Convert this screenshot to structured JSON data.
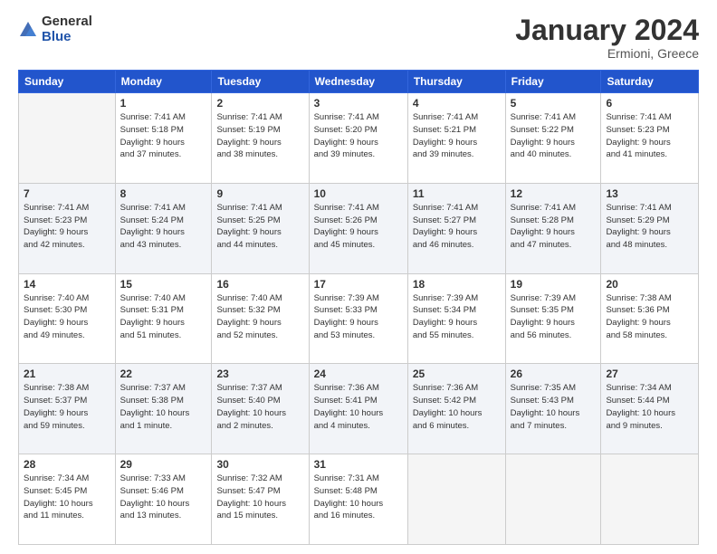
{
  "logo": {
    "general": "General",
    "blue": "Blue"
  },
  "header": {
    "title": "January 2024",
    "subtitle": "Ermioni, Greece"
  },
  "weekdays": [
    "Sunday",
    "Monday",
    "Tuesday",
    "Wednesday",
    "Thursday",
    "Friday",
    "Saturday"
  ],
  "weeks": [
    [
      {
        "day": "",
        "info": ""
      },
      {
        "day": "1",
        "info": "Sunrise: 7:41 AM\nSunset: 5:18 PM\nDaylight: 9 hours\nand 37 minutes."
      },
      {
        "day": "2",
        "info": "Sunrise: 7:41 AM\nSunset: 5:19 PM\nDaylight: 9 hours\nand 38 minutes."
      },
      {
        "day": "3",
        "info": "Sunrise: 7:41 AM\nSunset: 5:20 PM\nDaylight: 9 hours\nand 39 minutes."
      },
      {
        "day": "4",
        "info": "Sunrise: 7:41 AM\nSunset: 5:21 PM\nDaylight: 9 hours\nand 39 minutes."
      },
      {
        "day": "5",
        "info": "Sunrise: 7:41 AM\nSunset: 5:22 PM\nDaylight: 9 hours\nand 40 minutes."
      },
      {
        "day": "6",
        "info": "Sunrise: 7:41 AM\nSunset: 5:23 PM\nDaylight: 9 hours\nand 41 minutes."
      }
    ],
    [
      {
        "day": "7",
        "info": "Sunrise: 7:41 AM\nSunset: 5:23 PM\nDaylight: 9 hours\nand 42 minutes."
      },
      {
        "day": "8",
        "info": "Sunrise: 7:41 AM\nSunset: 5:24 PM\nDaylight: 9 hours\nand 43 minutes."
      },
      {
        "day": "9",
        "info": "Sunrise: 7:41 AM\nSunset: 5:25 PM\nDaylight: 9 hours\nand 44 minutes."
      },
      {
        "day": "10",
        "info": "Sunrise: 7:41 AM\nSunset: 5:26 PM\nDaylight: 9 hours\nand 45 minutes."
      },
      {
        "day": "11",
        "info": "Sunrise: 7:41 AM\nSunset: 5:27 PM\nDaylight: 9 hours\nand 46 minutes."
      },
      {
        "day": "12",
        "info": "Sunrise: 7:41 AM\nSunset: 5:28 PM\nDaylight: 9 hours\nand 47 minutes."
      },
      {
        "day": "13",
        "info": "Sunrise: 7:41 AM\nSunset: 5:29 PM\nDaylight: 9 hours\nand 48 minutes."
      }
    ],
    [
      {
        "day": "14",
        "info": "Sunrise: 7:40 AM\nSunset: 5:30 PM\nDaylight: 9 hours\nand 49 minutes."
      },
      {
        "day": "15",
        "info": "Sunrise: 7:40 AM\nSunset: 5:31 PM\nDaylight: 9 hours\nand 51 minutes."
      },
      {
        "day": "16",
        "info": "Sunrise: 7:40 AM\nSunset: 5:32 PM\nDaylight: 9 hours\nand 52 minutes."
      },
      {
        "day": "17",
        "info": "Sunrise: 7:39 AM\nSunset: 5:33 PM\nDaylight: 9 hours\nand 53 minutes."
      },
      {
        "day": "18",
        "info": "Sunrise: 7:39 AM\nSunset: 5:34 PM\nDaylight: 9 hours\nand 55 minutes."
      },
      {
        "day": "19",
        "info": "Sunrise: 7:39 AM\nSunset: 5:35 PM\nDaylight: 9 hours\nand 56 minutes."
      },
      {
        "day": "20",
        "info": "Sunrise: 7:38 AM\nSunset: 5:36 PM\nDaylight: 9 hours\nand 58 minutes."
      }
    ],
    [
      {
        "day": "21",
        "info": "Sunrise: 7:38 AM\nSunset: 5:37 PM\nDaylight: 9 hours\nand 59 minutes."
      },
      {
        "day": "22",
        "info": "Sunrise: 7:37 AM\nSunset: 5:38 PM\nDaylight: 10 hours\nand 1 minute."
      },
      {
        "day": "23",
        "info": "Sunrise: 7:37 AM\nSunset: 5:40 PM\nDaylight: 10 hours\nand 2 minutes."
      },
      {
        "day": "24",
        "info": "Sunrise: 7:36 AM\nSunset: 5:41 PM\nDaylight: 10 hours\nand 4 minutes."
      },
      {
        "day": "25",
        "info": "Sunrise: 7:36 AM\nSunset: 5:42 PM\nDaylight: 10 hours\nand 6 minutes."
      },
      {
        "day": "26",
        "info": "Sunrise: 7:35 AM\nSunset: 5:43 PM\nDaylight: 10 hours\nand 7 minutes."
      },
      {
        "day": "27",
        "info": "Sunrise: 7:34 AM\nSunset: 5:44 PM\nDaylight: 10 hours\nand 9 minutes."
      }
    ],
    [
      {
        "day": "28",
        "info": "Sunrise: 7:34 AM\nSunset: 5:45 PM\nDaylight: 10 hours\nand 11 minutes."
      },
      {
        "day": "29",
        "info": "Sunrise: 7:33 AM\nSunset: 5:46 PM\nDaylight: 10 hours\nand 13 minutes."
      },
      {
        "day": "30",
        "info": "Sunrise: 7:32 AM\nSunset: 5:47 PM\nDaylight: 10 hours\nand 15 minutes."
      },
      {
        "day": "31",
        "info": "Sunrise: 7:31 AM\nSunset: 5:48 PM\nDaylight: 10 hours\nand 16 minutes."
      },
      {
        "day": "",
        "info": ""
      },
      {
        "day": "",
        "info": ""
      },
      {
        "day": "",
        "info": ""
      }
    ]
  ]
}
